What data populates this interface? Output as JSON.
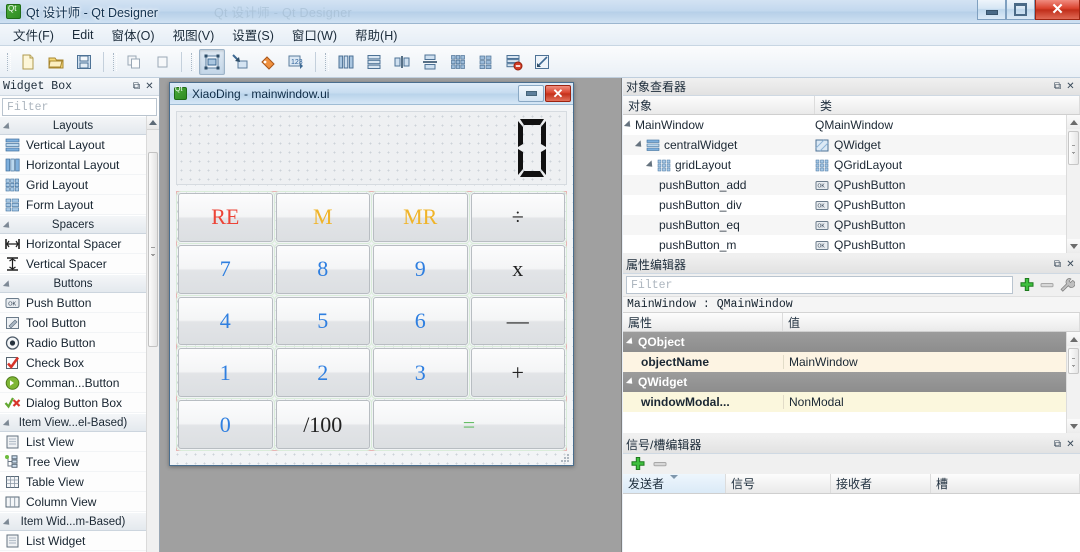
{
  "window": {
    "title": "Qt 设计师 - Qt Designer",
    "ghost_title": "Qt 设计师 - Qt Designer",
    "app_icon": "qt-logo-icon",
    "minimize_label": "",
    "maximize_label": "",
    "close_label": "✕"
  },
  "menubar": {
    "items": [
      {
        "label": "文件(F)"
      },
      {
        "label": "Edit"
      },
      {
        "label": "窗体(O)"
      },
      {
        "label": "视图(V)"
      },
      {
        "label": "设置(S)"
      },
      {
        "label": "窗口(W)"
      },
      {
        "label": "帮助(H)"
      }
    ]
  },
  "toolbar": {
    "groups": [
      {
        "buttons": [
          {
            "name": "new-form-icon",
            "active": false
          },
          {
            "name": "open-form-icon",
            "active": false
          },
          {
            "name": "save-form-icon",
            "active": false
          }
        ]
      },
      {
        "buttons": [
          {
            "name": "copy-icon",
            "active": false
          },
          {
            "name": "paste-icon",
            "active": false
          }
        ]
      },
      {
        "buttons": [
          {
            "name": "edit-widgets-icon",
            "active": true
          },
          {
            "name": "edit-signals-slots-icon",
            "active": false
          },
          {
            "name": "edit-buddies-icon",
            "active": false
          },
          {
            "name": "edit-tab-order-icon",
            "active": false
          }
        ]
      },
      {
        "buttons": [
          {
            "name": "layout-horizontally-icon",
            "active": false
          },
          {
            "name": "layout-vertically-icon",
            "active": false
          },
          {
            "name": "layout-splitter-horizontal-icon",
            "active": false
          },
          {
            "name": "layout-splitter-vertical-icon",
            "active": false
          },
          {
            "name": "layout-grid-icon",
            "active": false
          },
          {
            "name": "layout-form-icon",
            "active": false
          },
          {
            "name": "break-layout-icon",
            "active": false
          },
          {
            "name": "adjust-size-icon",
            "active": false
          }
        ]
      }
    ]
  },
  "widget_box": {
    "title": "Widget Box",
    "float_label": "⧉",
    "close_label": "✕",
    "filter_placeholder": "Filter",
    "sections": [
      {
        "label": "Layouts",
        "items": [
          {
            "label": "Vertical Layout",
            "icon": "vertical-layout-icon"
          },
          {
            "label": "Horizontal Layout",
            "icon": "horizontal-layout-icon"
          },
          {
            "label": "Grid Layout",
            "icon": "grid-layout-icon"
          },
          {
            "label": "Form Layout",
            "icon": "form-layout-icon"
          }
        ]
      },
      {
        "label": "Spacers",
        "items": [
          {
            "label": "Horizontal Spacer",
            "icon": "horizontal-spacer-icon"
          },
          {
            "label": "Vertical Spacer",
            "icon": "vertical-spacer-icon"
          }
        ]
      },
      {
        "label": "Buttons",
        "items": [
          {
            "label": "Push Button",
            "icon": "push-button-icon"
          },
          {
            "label": "Tool Button",
            "icon": "tool-button-icon"
          },
          {
            "label": "Radio Button",
            "icon": "radio-button-icon"
          },
          {
            "label": "Check Box",
            "icon": "check-box-icon"
          },
          {
            "label": "Comman...Button",
            "icon": "command-link-button-icon"
          },
          {
            "label": "Dialog Button Box",
            "icon": "dialog-button-box-icon"
          }
        ]
      },
      {
        "label": "Item View...el-Based)",
        "items": [
          {
            "label": "List View",
            "icon": "list-view-icon"
          },
          {
            "label": "Tree View",
            "icon": "tree-view-icon"
          },
          {
            "label": "Table View",
            "icon": "table-view-icon"
          },
          {
            "label": "Column View",
            "icon": "column-view-icon"
          }
        ]
      },
      {
        "label": "Item Wid...m-Based)",
        "items": [
          {
            "label": "List Widget",
            "icon": "list-widget-icon"
          }
        ]
      }
    ]
  },
  "form_window": {
    "title": "XiaoDing - mainwindow.ui",
    "icon": "qt-logo-icon",
    "minimize_label": "",
    "close_label": "✕",
    "lcd_value": "0",
    "buttons": [
      {
        "label": "RE",
        "color_class": "c-red",
        "span": 1
      },
      {
        "label": "M",
        "color_class": "c-gold",
        "span": 1
      },
      {
        "label": "MR",
        "color_class": "c-gold",
        "span": 1
      },
      {
        "label": "÷",
        "color_class": "",
        "span": 1
      },
      {
        "label": "7",
        "color_class": "c-blue",
        "span": 1
      },
      {
        "label": "8",
        "color_class": "c-blue",
        "span": 1
      },
      {
        "label": "9",
        "color_class": "c-blue",
        "span": 1
      },
      {
        "label": "x",
        "color_class": "",
        "span": 1
      },
      {
        "label": "4",
        "color_class": "c-blue",
        "span": 1
      },
      {
        "label": "5",
        "color_class": "c-blue",
        "span": 1
      },
      {
        "label": "6",
        "color_class": "c-blue",
        "span": 1
      },
      {
        "label": "—",
        "color_class": "",
        "span": 1
      },
      {
        "label": "1",
        "color_class": "c-blue",
        "span": 1
      },
      {
        "label": "2",
        "color_class": "c-blue",
        "span": 1
      },
      {
        "label": "3",
        "color_class": "c-blue",
        "span": 1
      },
      {
        "label": "+",
        "color_class": "",
        "span": 1
      },
      {
        "label": "0",
        "color_class": "c-blue",
        "span": 1
      },
      {
        "label": "/100",
        "color_class": "",
        "span": 1
      },
      {
        "label": "=",
        "color_class": "c-green",
        "span": 2
      }
    ]
  },
  "object_inspector": {
    "title": "对象查看器",
    "float_label": "⧉",
    "close_label": "✕",
    "columns": [
      "对象",
      "类"
    ],
    "rows": [
      {
        "object": "MainWindow",
        "cls": "QMainWindow",
        "depth": 0,
        "expanded": true,
        "icon": ""
      },
      {
        "object": "centralWidget",
        "cls": "QWidget",
        "depth": 1,
        "expanded": true,
        "icon": "vertical-layout-icon",
        "cls_icon": "widget-icon"
      },
      {
        "object": "gridLayout",
        "cls": "QGridLayout",
        "depth": 2,
        "expanded": true,
        "icon": "grid-layout-icon",
        "cls_icon": "grid-layout-icon"
      },
      {
        "object": "pushButton_add",
        "cls": "QPushButton",
        "depth": 3,
        "expanded": false,
        "icon": "",
        "cls_icon": "push-button-icon"
      },
      {
        "object": "pushButton_div",
        "cls": "QPushButton",
        "depth": 3,
        "expanded": false,
        "icon": "",
        "cls_icon": "push-button-icon"
      },
      {
        "object": "pushButton_eq",
        "cls": "QPushButton",
        "depth": 3,
        "expanded": false,
        "icon": "",
        "cls_icon": "push-button-icon"
      },
      {
        "object": "pushButton_m",
        "cls": "QPushButton",
        "depth": 3,
        "expanded": false,
        "icon": "",
        "cls_icon": "push-button-icon"
      }
    ]
  },
  "property_editor": {
    "title": "属性编辑器",
    "float_label": "⧉",
    "close_label": "✕",
    "filter_placeholder": "Filter",
    "add_label": "+",
    "remove_label": "—",
    "configure_label": "🔧",
    "object_line": "MainWindow : QMainWindow",
    "columns": [
      "属性",
      "值"
    ],
    "rows": [
      {
        "kind": "group",
        "key": "QObject",
        "value": ""
      },
      {
        "kind": "value",
        "key": "objectName",
        "value": "MainWindow"
      },
      {
        "kind": "group",
        "key": "QWidget",
        "value": ""
      },
      {
        "kind": "value",
        "key": "windowModal...",
        "value": "NonModal"
      }
    ]
  },
  "signal_slot_editor": {
    "title": "信号/槽编辑器",
    "float_label": "⧉",
    "close_label": "✕",
    "add_label": "+",
    "remove_label": "—",
    "columns": [
      "发送者",
      "信号",
      "接收者",
      "槽"
    ],
    "rows": []
  },
  "colors": {
    "accent_blue": "#2f7fe0",
    "red": "#ec4437",
    "gold": "#f0b429",
    "green": "#67bd67",
    "mdi_background": "#a0a0a0",
    "titlebar": "#c2d8ee"
  }
}
